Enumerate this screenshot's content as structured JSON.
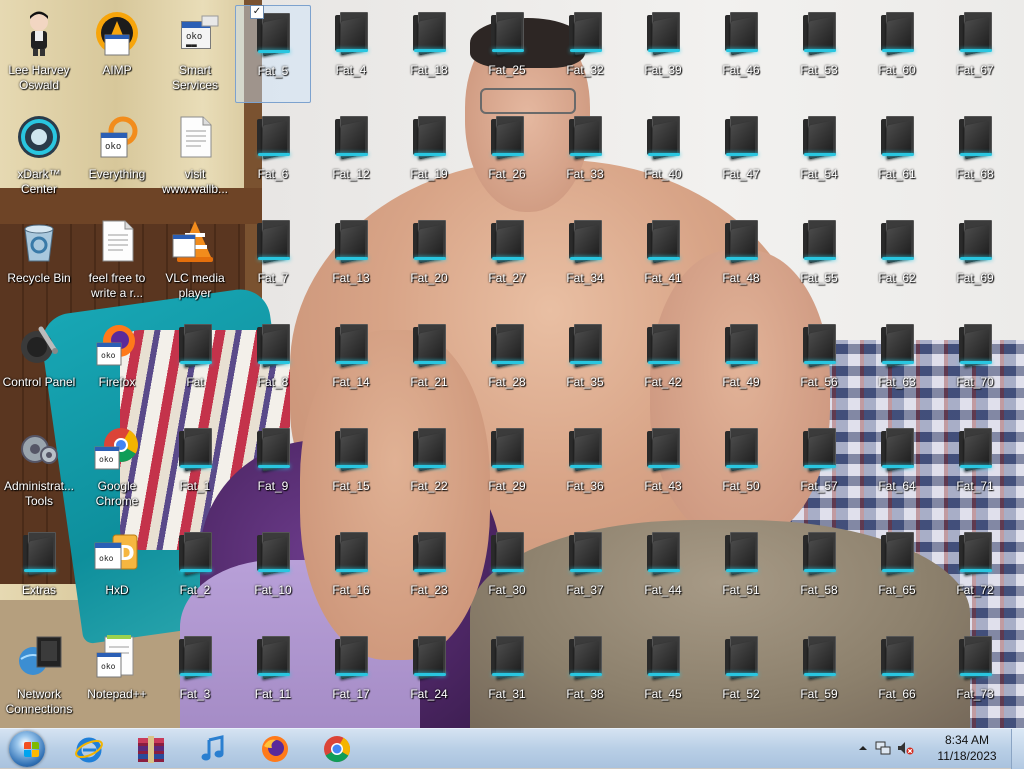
{
  "desktop": {
    "system_icons": [
      {
        "name": "lee-harvey-oswald",
        "label": "Lee Harvey Oswald",
        "icon": "figure-icon"
      },
      {
        "name": "aimp",
        "label": "AIMP",
        "icon": "aimp-icon"
      },
      {
        "name": "smart-services",
        "label": "Smart Services",
        "icon": "program-icon"
      },
      {
        "name": "xdark-center",
        "label": "xDark™ Center",
        "icon": "xdark-icon"
      },
      {
        "name": "everything",
        "label": "Everything",
        "icon": "everything-icon"
      },
      {
        "name": "visit-wallb",
        "label": "visit www.wallb...",
        "icon": "document-icon"
      },
      {
        "name": "recycle-bin",
        "label": "Recycle Bin",
        "icon": "recycle-bin-icon"
      },
      {
        "name": "feel-free",
        "label": "feel free to write a r...",
        "icon": "document-icon"
      },
      {
        "name": "vlc",
        "label": "VLC media player",
        "icon": "vlc-icon"
      },
      {
        "name": "control-panel",
        "label": "Control Panel",
        "icon": "control-panel-icon"
      },
      {
        "name": "firefox",
        "label": "Firefox",
        "icon": "firefox-icon"
      },
      {
        "name": "fat",
        "label": "Fat",
        "icon": "folder-icon"
      },
      {
        "name": "admin-tools",
        "label": "Administrat... Tools",
        "icon": "tools-icon"
      },
      {
        "name": "google-chrome",
        "label": "Google Chrome",
        "icon": "chrome-icon"
      },
      {
        "name": "fat-1",
        "label": "Fat_1",
        "icon": "folder-icon"
      },
      {
        "name": "extras",
        "label": "Extras",
        "icon": "folder-icon"
      },
      {
        "name": "hxd",
        "label": "HxD",
        "icon": "hxd-icon"
      },
      {
        "name": "fat-2",
        "label": "Fat_2",
        "icon": "folder-icon"
      },
      {
        "name": "network-connections",
        "label": "Network Connections",
        "icon": "network-icon"
      },
      {
        "name": "notepad-plus",
        "label": "Notepad++",
        "icon": "notepad-icon"
      },
      {
        "name": "fat-3",
        "label": "Fat_3",
        "icon": "folder-icon"
      }
    ],
    "folder_columns": [
      [
        "Fat_5",
        "Fat_6",
        "Fat_7",
        "Fat_8",
        "Fat_9",
        "Fat_10",
        "Fat_11"
      ],
      [
        "Fat_4",
        "Fat_12",
        "Fat_13",
        "Fat_14",
        "Fat_15",
        "Fat_16",
        "Fat_17"
      ],
      [
        "Fat_18",
        "Fat_19",
        "Fat_20",
        "Fat_21",
        "Fat_22",
        "Fat_23",
        "Fat_24"
      ],
      [
        "Fat_25",
        "Fat_26",
        "Fat_27",
        "Fat_28",
        "Fat_29",
        "Fat_30",
        "Fat_31"
      ],
      [
        "Fat_32",
        "Fat_33",
        "Fat_34",
        "Fat_35",
        "Fat_36",
        "Fat_37",
        "Fat_38"
      ],
      [
        "Fat_39",
        "Fat_40",
        "Fat_41",
        "Fat_42",
        "Fat_43",
        "Fat_44",
        "Fat_45"
      ],
      [
        "Fat_46",
        "Fat_47",
        "Fat_48",
        "Fat_49",
        "Fat_50",
        "Fat_51",
        "Fat_52"
      ],
      [
        "Fat_53",
        "Fat_54",
        "Fat_55",
        "Fat_56",
        "Fat_57",
        "Fat_58",
        "Fat_59"
      ],
      [
        "Fat_60",
        "Fat_61",
        "Fat_62",
        "Fat_63",
        "Fat_64",
        "Fat_65",
        "Fat_66"
      ],
      [
        "Fat_67",
        "Fat_68",
        "Fat_69",
        "Fat_70",
        "Fat_71",
        "Fat_72",
        "Fat_73"
      ]
    ],
    "selected_item": "Fat_5"
  },
  "taskbar": {
    "start_icon": "windows-start-orb-icon",
    "pinned": [
      {
        "name": "internet-explorer",
        "icon": "internet-explorer-icon"
      },
      {
        "name": "winrar",
        "icon": "archive-icon"
      },
      {
        "name": "itunes",
        "icon": "music-note-icon"
      },
      {
        "name": "firefox",
        "icon": "firefox-icon"
      },
      {
        "name": "chrome",
        "icon": "chrome-icon"
      }
    ],
    "tray": {
      "overflow_icon": "chevron-up-icon",
      "network_icon": "network-status-icon",
      "volume_icon": "speaker-muted-icon",
      "time": "8:34 AM",
      "date": "11/18/2023"
    }
  },
  "colors": {
    "folder_glow": "#29c6e0",
    "taskbar_top": "#d5e3f2",
    "taskbar_bottom": "#a9c2de",
    "selection_border": "#7da2ce"
  }
}
